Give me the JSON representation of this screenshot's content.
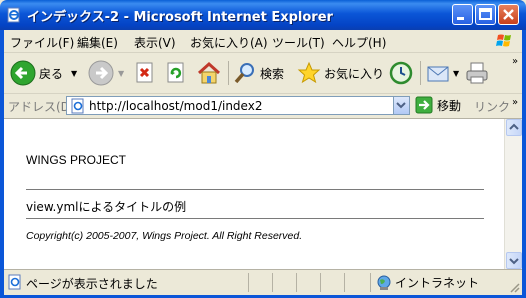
{
  "window": {
    "title": "インデックス-2 - Microsoft Internet Explorer"
  },
  "menu": [
    "ファイル(F)",
    "編集(E)",
    "表示(V)",
    "お気に入り(A)",
    "ツール(T)",
    "ヘルプ(H)"
  ],
  "toolbar": {
    "back_label": "戻る",
    "search_label": "検索",
    "favorites_label": "お気に入り"
  },
  "address": {
    "label": "アドレス(D)",
    "url": "http://localhost/mod1/index2",
    "go_label": "移動",
    "links_label": "リンク"
  },
  "page": {
    "heading": "WINGS PROJECT",
    "body": "view.ymlによるタイトルの例",
    "copyright": "Copyright(c) 2005-2007, Wings Project. All Right Reserved."
  },
  "status": {
    "text": "ページが表示されました",
    "zone": "イントラネット"
  }
}
